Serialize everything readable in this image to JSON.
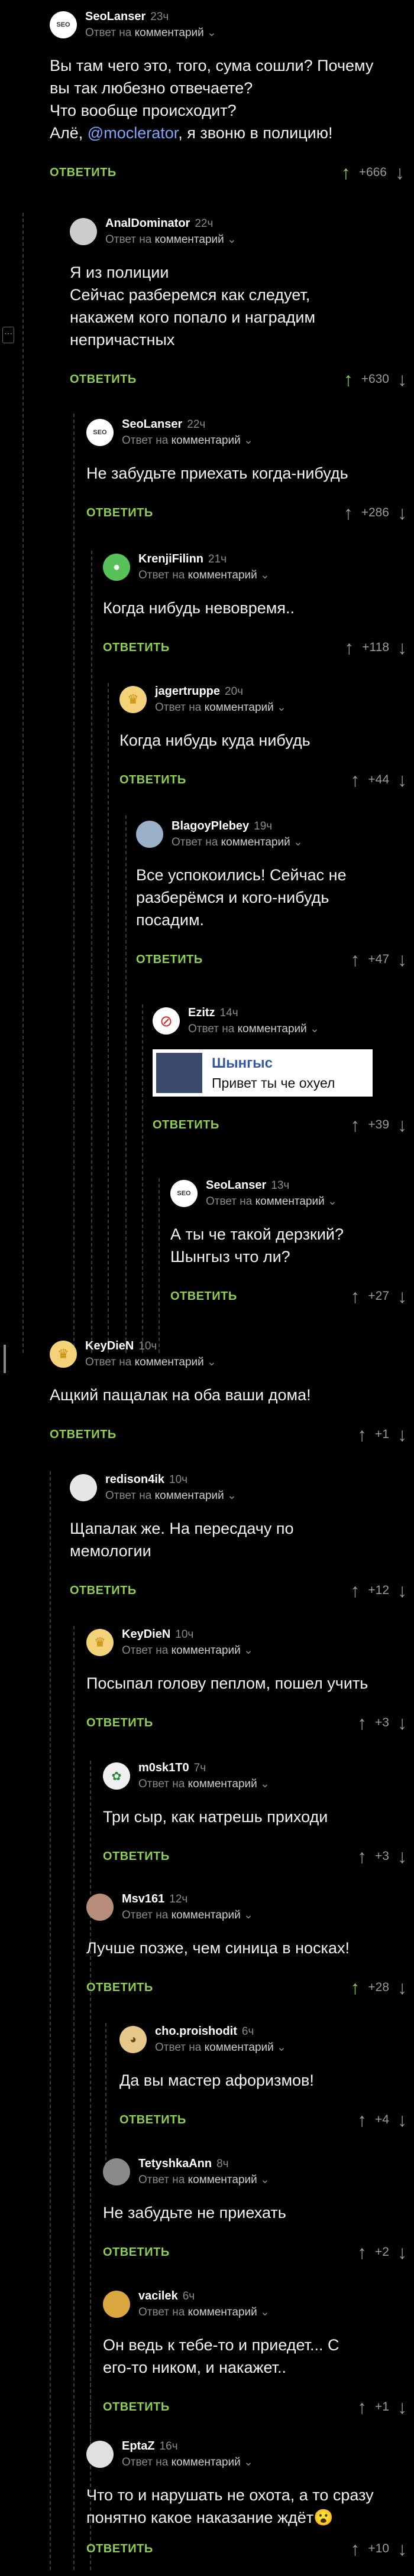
{
  "ui": {
    "reply_label": "ОТВЕТИТЬ",
    "reply_prefix": "Ответ на",
    "reply_target": "комментарий"
  },
  "comments": [
    {
      "user": "SeoLanser",
      "time": "23ч",
      "body_lines": [
        "Вы там чего это, того, сума сошли? Почему",
        "вы так любезно отвечаете?",
        "Что вообще происходит?"
      ],
      "body_mention_pre": "Алё, ",
      "mention": "@moclerator",
      "body_mention_post": ", я звоню в полицию!",
      "votes": "+666"
    },
    {
      "user": "AnalDominator",
      "time": "22ч",
      "body_lines": [
        "Я из полиции",
        "Сейчас разберемся как следует,",
        "накажем кого попало и наградим",
        "непричастных"
      ],
      "votes": "+630"
    },
    {
      "user": "SeoLanser",
      "time": "22ч",
      "body_lines": [
        "Не забудьте приехать когда-нибудь"
      ],
      "votes": "+286"
    },
    {
      "user": "KrenjiFilinn",
      "time": "21ч",
      "body_lines": [
        "Когда нибудь невовремя.."
      ],
      "votes": "+118"
    },
    {
      "user": "jagertruppe",
      "time": "20ч",
      "body_lines": [
        "Когда нибудь куда нибудь"
      ],
      "votes": "+44"
    },
    {
      "user": "BlagoyPlebey",
      "time": "19ч",
      "body_lines": [
        "Все успокоились! Сейчас не",
        "разберёмся и кого-нибудь",
        "посадим."
      ],
      "votes": "+47"
    },
    {
      "user": "Ezitz",
      "time": "14ч",
      "quote_name": "Шынгыс",
      "quote_text": "Привет ты че охуел",
      "votes": "+39"
    },
    {
      "user": "SeoLanser",
      "time": "13ч",
      "body_lines": [
        "А ты че такой дерзкий?",
        "Шынгыз что ли?"
      ],
      "votes": "+27"
    },
    {
      "user": "KeyDieN",
      "time": "10ч",
      "body_lines": [
        "Ащкий пащалак на оба ваши дома!"
      ],
      "votes": "+1"
    },
    {
      "user": "redison4ik",
      "time": "10ч",
      "body_lines": [
        "Щапалак же. На пересдачу по",
        "мемологии"
      ],
      "votes": "+12"
    },
    {
      "user": "KeyDieN",
      "time": "10ч",
      "body_lines": [
        "Посыпал голову пеплом, пошел учить"
      ],
      "votes": "+3"
    },
    {
      "user": "m0sk1T0",
      "time": "7ч",
      "body_lines": [
        "Три сыр, как натрешь приходи"
      ],
      "votes": "+3"
    },
    {
      "user": "Msv161",
      "time": "12ч",
      "body_lines": [
        "Лучше позже, чем синица в носках!"
      ],
      "votes": "+28"
    },
    {
      "user": "cho.proishodit",
      "time": "6ч",
      "body_lines": [
        "Да вы мастер афоризмов!"
      ],
      "votes": "+4"
    },
    {
      "user": "TetyshkaAnn",
      "time": "8ч",
      "body_lines": [
        "Не забудьте не приехать"
      ],
      "votes": "+2"
    },
    {
      "user": "vacilek",
      "time": "6ч",
      "body_lines": [
        "Он ведь к тебе-то и приедет... С",
        "его-то ником, и накажет.."
      ],
      "votes": "+1"
    },
    {
      "user": "EptaZ",
      "time": "16ч",
      "body_lines": [
        "Что то и нарушать не охота, а то сразу",
        "понятно какое наказание ждёт😮"
      ],
      "votes": "+10"
    }
  ],
  "colors": {
    "accent": "#8fcf4f",
    "mention": "#7fa7ff",
    "background": "#000000"
  },
  "icons": {
    "upvote": "arrow-up-icon",
    "downvote": "arrow-down-icon",
    "chevron": "chevron-down-icon"
  }
}
